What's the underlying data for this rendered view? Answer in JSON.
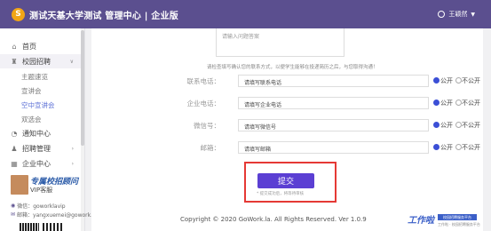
{
  "header": {
    "logo_glyph": "S",
    "title": "测试天基大学测试 管理中心 | 企业版",
    "user_name": "王颖然"
  },
  "sidebar": {
    "items": [
      {
        "label": "首页",
        "icon": "home-icon"
      },
      {
        "label": "校园招聘",
        "icon": "graduation-icon"
      },
      {
        "label": "通知中心",
        "icon": "bell-icon"
      },
      {
        "label": "招聘管理",
        "icon": "user-icon"
      },
      {
        "label": "企业中心",
        "icon": "building-icon"
      }
    ],
    "sub_items": [
      {
        "label": "主题速览"
      },
      {
        "label": "宣讲会"
      },
      {
        "label": "空中宣讲会",
        "active": true
      },
      {
        "label": "双选会"
      }
    ],
    "vip": {
      "title": "专属校招顾问",
      "subtitle": "VIP客服"
    },
    "contacts": {
      "weibo": "微信：goworklavip",
      "email": "邮箱：yangxuemei@gowork.l"
    }
  },
  "form": {
    "textarea_placeholder": "请输入问题答案",
    "notice": "请检查填写确认您的联系方式，以便学生能够在投递简历之后，与您取得沟通！",
    "fields": [
      {
        "label": "联系电话：",
        "placeholder": "请填写联系电话"
      },
      {
        "label": "企业电话：",
        "placeholder": "请填写企业电话"
      },
      {
        "label": "微信号：",
        "placeholder": "请填写微信号"
      },
      {
        "label": "邮箱：",
        "placeholder": "请填写邮箱"
      }
    ],
    "public_label": "公开",
    "private_label": "不公开",
    "submit_label": "提交",
    "submit_hint": "* 提交成功后，将等待审核"
  },
  "footer": {
    "copyright": "Copyright © 2020 GoWork.la. All Rights Reserved. Ver 1.0.9",
    "brand_name": "工作啦",
    "brand_tag": "校园招聘服务平台",
    "brand_line": "工作啦 · 校园招聘服务平台"
  },
  "colors": {
    "header_bg": "#5b4f8f",
    "accent": "#5b3fd3",
    "highlight": "#e53935"
  }
}
